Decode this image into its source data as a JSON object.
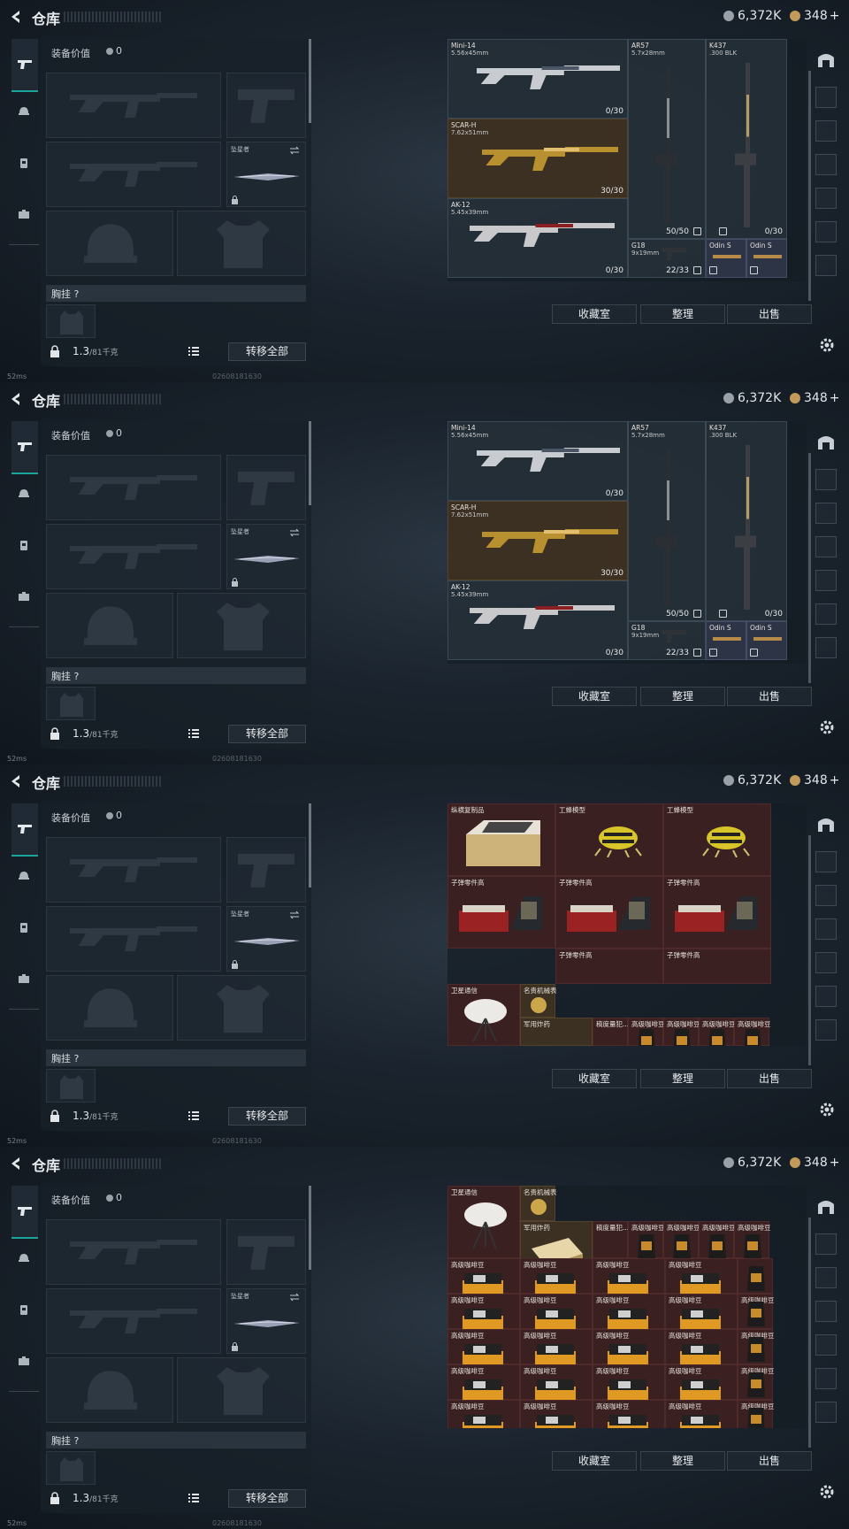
{
  "header": {
    "title": "仓库",
    "currency_silver": "6,372K",
    "currency_gold": "348",
    "gold_plus": "+"
  },
  "equipment": {
    "value_label": "装备价值",
    "value": "0",
    "melee_name": "坠星者",
    "chest_label": "胸挂",
    "chest_help": "?",
    "weight": "1.3",
    "weight_max": "/81千克",
    "transfer_all": "转移全部"
  },
  "status": {
    "ping": "52ms",
    "uid": "02608181630"
  },
  "buttons": {
    "collection": "收藏室",
    "sort": "整理",
    "sell": "出售"
  },
  "weapons": [
    {
      "name": "Mini-14",
      "caliber": "5.56x45mm",
      "ammo": "0/30"
    },
    {
      "name": "SCAR-H",
      "caliber": "7.62x51mm",
      "ammo": "30/30"
    },
    {
      "name": "AK-12",
      "caliber": "5.45x39mm",
      "ammo": "0/30"
    },
    {
      "name": "AR57",
      "caliber": "5.7x28mm",
      "ammo": "50/50"
    },
    {
      "name": "K437",
      "caliber": ".300 BLK",
      "ammo": "0/30"
    },
    {
      "name": "G18",
      "caliber": "9x19mm",
      "ammo": "22/33"
    },
    {
      "name": "Odin S",
      "caliber": ""
    },
    {
      "name": "Odin S",
      "caliber": ""
    }
  ],
  "loot_top": {
    "chess": "纵横复制品",
    "bee_a": "工蜂模型",
    "bee_b": "工蜂模型",
    "parts_a": "子弹零件高",
    "parts_b": "子弹零件高",
    "parts_c": "子弹零件高",
    "parts_d": "子弹零件高",
    "parts_e": "子弹零件高",
    "dish": "卫星通信",
    "watch": "名贵机械表",
    "ammo_box": "军用炸药",
    "card": "稿度量犯...",
    "coffee": "高级咖啡豆",
    "coffee_box": "高级咖啡豆"
  },
  "colors": {
    "accent": "#1aa598",
    "loot_red": "#3a2020",
    "loot_gold": "#3c3022",
    "silver_coin": "#9aa2a8",
    "gold_coin": "#c29a5a"
  },
  "icons": [
    "back-arrow-icon",
    "pistol-icon",
    "helmet-icon",
    "backpack-icon",
    "briefcase-icon",
    "lock-icon",
    "list-icon",
    "swap-icon",
    "gear-icon",
    "coin-icon"
  ]
}
